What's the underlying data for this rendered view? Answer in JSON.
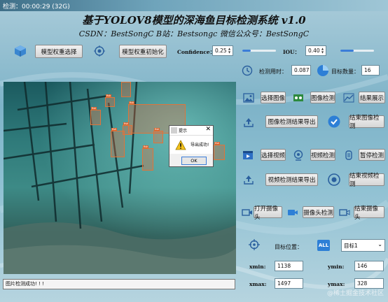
{
  "window": {
    "title": "检测：00:00:29 (32G)"
  },
  "app": {
    "title": "基于YOLOV8模型的深海鱼目标检测系统 v1.0",
    "subtitle": "CSDN：BestSongC   B站：Bestsongc   微信公众号：BestSongC"
  },
  "toolbar": {
    "model_select": "模型权重选择",
    "model_init": "模型权重初始化",
    "confidence_label": "Confidence：",
    "confidence_value": "0.25",
    "confidence_level": 0.25,
    "iou_label": "IOU：",
    "iou_value": "0.40",
    "iou_level": 0.4
  },
  "stats": {
    "time_label": "检测用时：",
    "time_value": "0.087",
    "count_label": "目标数量：",
    "count_value": "16"
  },
  "image_panel": {
    "select_image": "选择图像",
    "image_detect": "图像检测",
    "show_result": "结果展示",
    "export_image_result": "图像检测结果导出",
    "end_image_detect": "结束图像检测"
  },
  "video_panel": {
    "select_video": "选择视频",
    "video_detect": "视频检测",
    "pause_detect": "暂停检测",
    "export_video_result": "视频检测结果导出",
    "end_video_detect": "结束视频检测"
  },
  "camera_panel": {
    "open_camera": "打开摄像头",
    "camera_detect": "摄像头检测",
    "close_camera": "结束摄像头"
  },
  "target": {
    "position_label": "目标位置：",
    "all_badge": "ALL",
    "selected_target": "目标1",
    "xmin_label": "xmin:",
    "xmin_value": "1138",
    "ymin_label": "ymin:",
    "ymin_value": "146",
    "xmax_label": "xmax:",
    "xmax_value": "1497",
    "ymax_label": "ymax:",
    "ymax_value": "328"
  },
  "dialog": {
    "title": "提示",
    "message": "导出成功!",
    "ok": "OK",
    "close": "✕"
  },
  "status_bar": {
    "text": "图片检测成功! ! !"
  },
  "watermark": {
    "text": "@稀土掘金技术社区"
  },
  "colors": {
    "accent": "#3b7dd8",
    "detection_box": "#e0743a"
  }
}
